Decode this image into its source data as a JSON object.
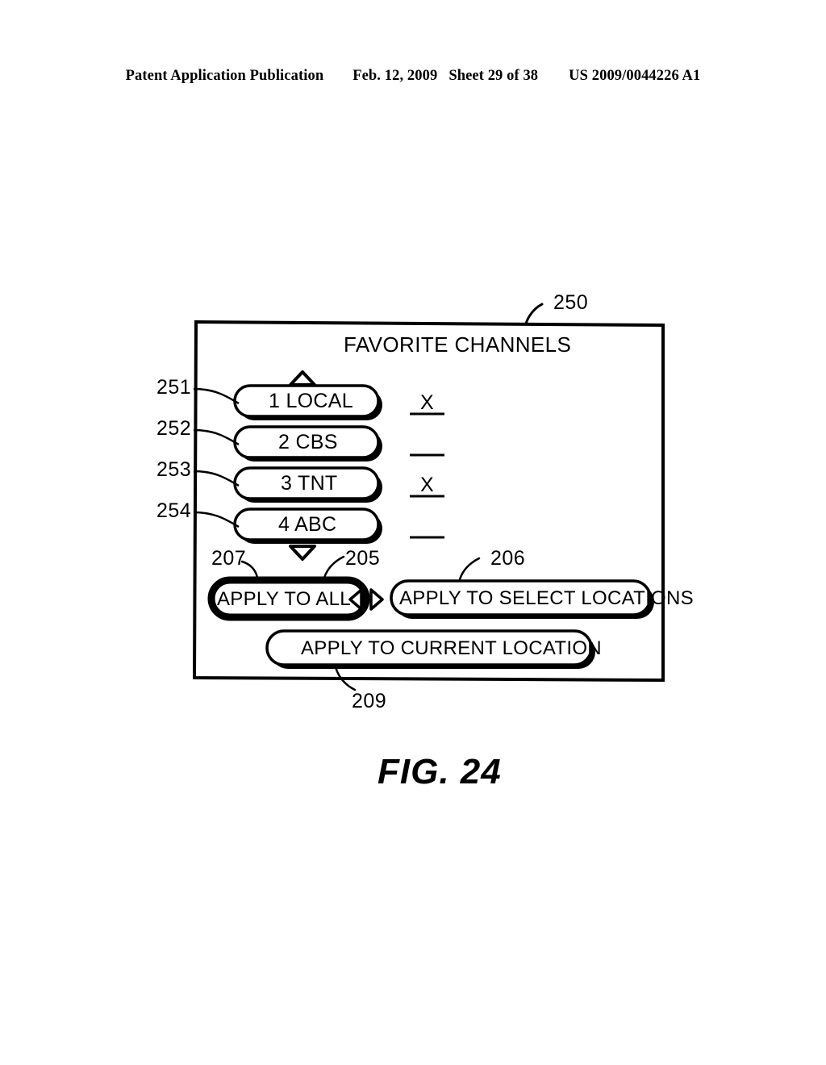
{
  "header": {
    "publication": "Patent Application Publication",
    "date": "Feb. 12, 2009",
    "sheet": "Sheet 29 of 38",
    "patent_number": "US 2009/0044226 A1"
  },
  "figure": {
    "caption": "FIG. 24",
    "screen_title": "FAVORITE CHANNELS",
    "screen_ref": "250",
    "scroll_up_icon": "triangle-up-icon",
    "scroll_down_icon": "triangle-down-icon",
    "nav_left_icon": "triangle-left-icon",
    "nav_right_icon": "triangle-right-icon",
    "channels": [
      {
        "ref": "251",
        "label": "1 LOCAL",
        "mark": "X",
        "selected": true
      },
      {
        "ref": "252",
        "label": "2 CBS",
        "mark": "",
        "selected": false
      },
      {
        "ref": "253",
        "label": "3 TNT",
        "mark": "X",
        "selected": false
      },
      {
        "ref": "254",
        "label": "4 ABC",
        "mark": "",
        "selected": false
      }
    ],
    "apply_buttons": [
      {
        "ref": "207",
        "alt_ref": "205",
        "label": "APPLY TO ALL",
        "highlighted": true
      },
      {
        "ref": "206",
        "label": "APPLY TO SELECT LOCATIONS",
        "highlighted": false
      },
      {
        "ref": "209",
        "label": "APPLY TO CURRENT LOCATION",
        "highlighted": false
      }
    ]
  },
  "colors": {
    "ink": "#000000",
    "paper": "#ffffff"
  }
}
